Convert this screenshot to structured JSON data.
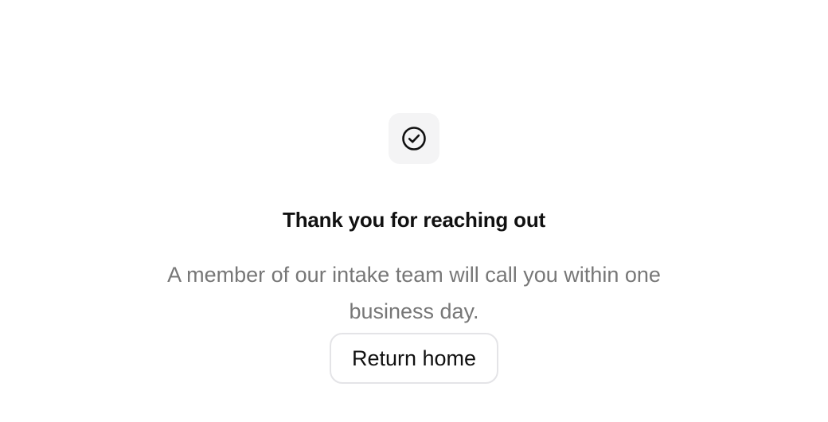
{
  "confirmation": {
    "icon": "check-circle-icon",
    "title": "Thank you for reaching out",
    "message": "A member of our intake team will call you within one business day.",
    "button_label": "Return home"
  },
  "colors": {
    "background": "#ffffff",
    "icon_tile": "#f4f4f5",
    "title_text": "#111111",
    "message_text": "#777777",
    "button_border": "#e4e4e7"
  }
}
